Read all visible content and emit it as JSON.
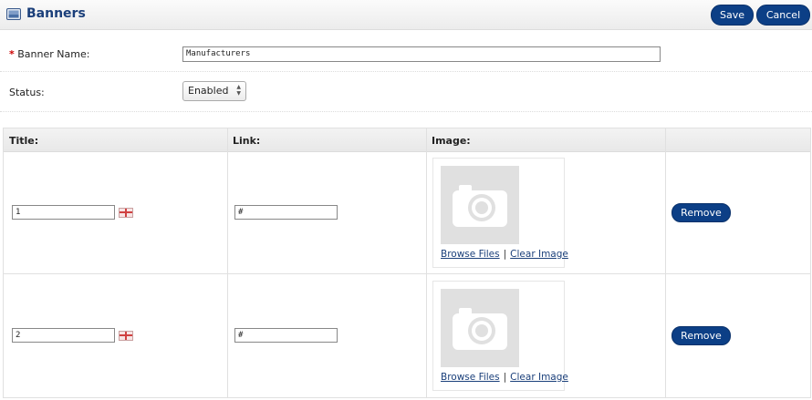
{
  "header": {
    "title": "Banners",
    "save_label": "Save",
    "cancel_label": "Cancel",
    "icon": "banner-image-icon"
  },
  "form": {
    "banner_name_label": "Banner Name:",
    "banner_name_value": "Manufacturers",
    "status_label": "Status:",
    "status_value": "Enabled"
  },
  "table": {
    "columns": [
      "Title:",
      "Link:",
      "Image:",
      ""
    ],
    "rows": [
      {
        "title": "1",
        "link": "#",
        "browse": "Browse Files",
        "sep": "|",
        "clear": "Clear Image",
        "remove": "Remove"
      },
      {
        "title": "2",
        "link": "#",
        "browse": "Browse Files",
        "sep": "|",
        "clear": "Clear Image",
        "remove": "Remove"
      }
    ]
  },
  "colors": {
    "accent": "#0c3f86",
    "title": "#1b3f7a",
    "required": "#cc0000"
  }
}
